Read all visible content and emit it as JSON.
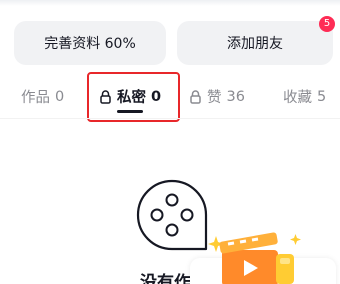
{
  "profile_actions": {
    "complete_profile_label": "完善资料 60%",
    "add_friends_label": "添加朋友",
    "add_friends_badge": "5"
  },
  "tabs": [
    {
      "label": "作品",
      "count": "0"
    },
    {
      "label": "私密",
      "count": "0",
      "locked": true,
      "active": true
    },
    {
      "label": "赞",
      "count": "36",
      "locked": true
    },
    {
      "label": "收藏",
      "count": "5"
    }
  ],
  "empty_state": {
    "icon": "film-reel-icon",
    "text": "没有作"
  },
  "colors": {
    "accent_red": "#fe2c55",
    "highlight_border": "#e8272a",
    "promo_orange": "#ff8a2a",
    "promo_gold": "#ffcc33"
  }
}
